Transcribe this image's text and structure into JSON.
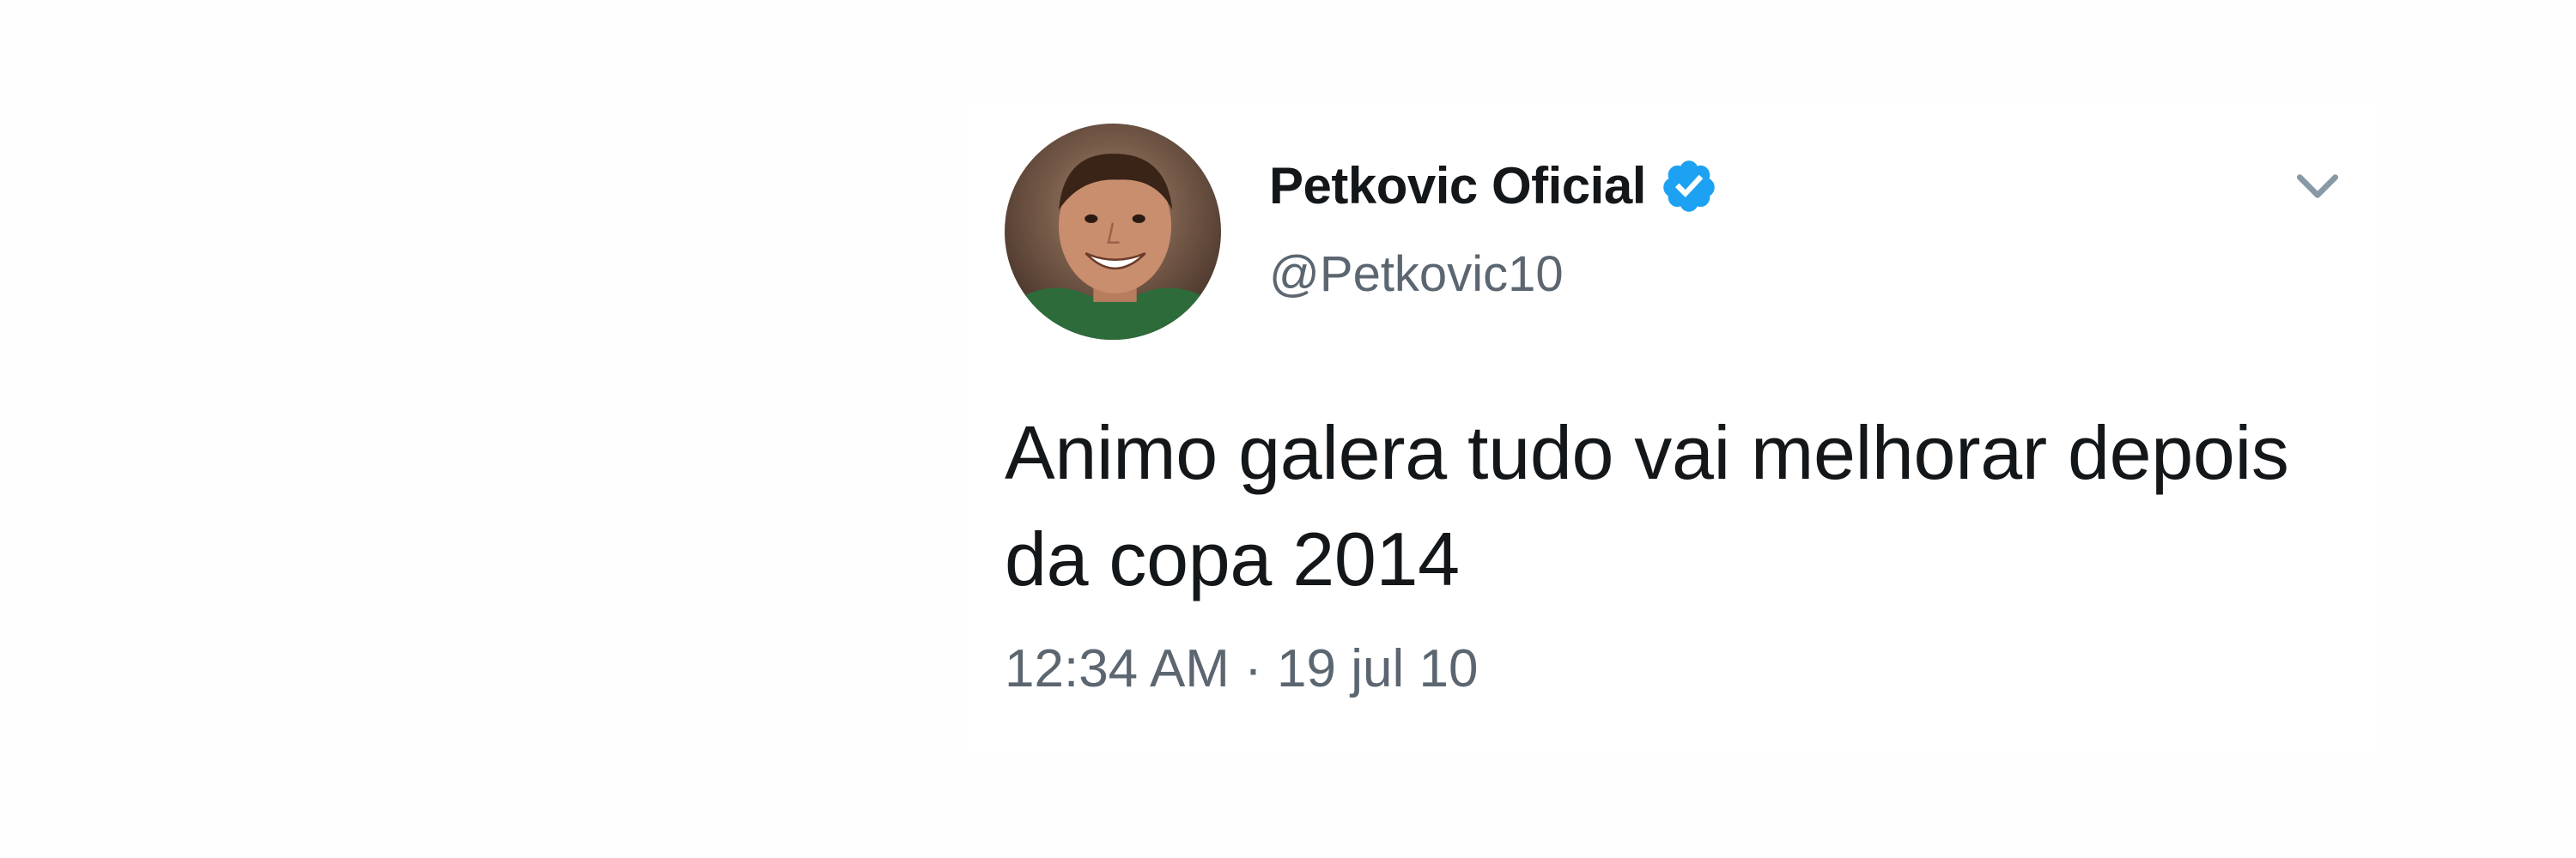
{
  "tweet": {
    "display_name": "Petkovic Oficial",
    "handle": "@Petkovic10",
    "text": "Animo galera tudo vai melhorar depois da copa 2014",
    "timestamp": "12:34 AM · 19 jul 10",
    "verified": true
  },
  "icons": {
    "verified": "verified-badge-icon",
    "menu": "chevron-down-icon"
  },
  "colors": {
    "name": "#14171a",
    "secondary": "#5b6670",
    "verified_blue": "#1da1f2"
  }
}
